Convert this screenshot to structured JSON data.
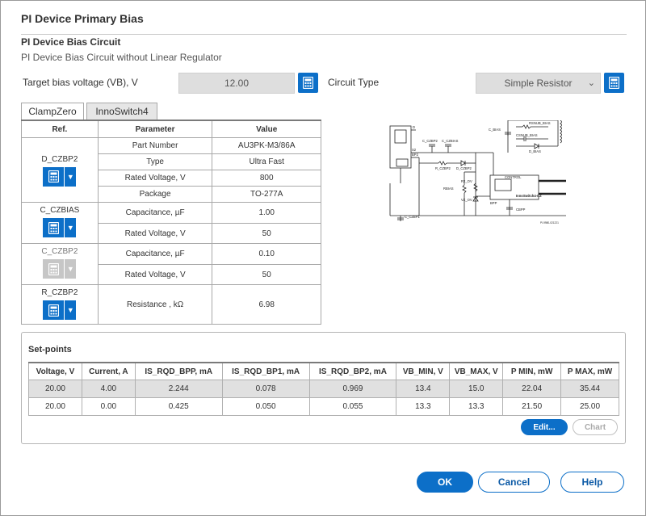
{
  "dialog": {
    "title": "PI Device Primary Bias",
    "section_title": "PI Device Bias Circuit",
    "section_subtitle": "PI Device Bias Circuit without Linear Regulator"
  },
  "inputs": {
    "target_bias_label": "Target bias voltage (VB), V",
    "target_bias_value": "12.00",
    "circuit_type_label": "Circuit Type",
    "circuit_type_value": "Simple Resistor"
  },
  "tabs": [
    {
      "label": "ClampZero",
      "active": true
    },
    {
      "label": "InnoSwitch4",
      "active": false
    }
  ],
  "components_table": {
    "headers": [
      "Ref.",
      "Parameter",
      "Value"
    ],
    "groups": [
      {
        "ref": "D_CZBP2",
        "enabled": true,
        "rows": [
          {
            "parameter": "Part Number",
            "value": "AU3PK-M3/86A"
          },
          {
            "parameter": "Type",
            "value": "Ultra Fast"
          },
          {
            "parameter": "Rated Voltage, V",
            "value": "800"
          },
          {
            "parameter": "Package",
            "value": "TO-277A"
          }
        ]
      },
      {
        "ref": "C_CZBIAS",
        "enabled": true,
        "rows": [
          {
            "parameter": "Capacitance, µF",
            "value": "1.00"
          },
          {
            "parameter": "Rated Voltage, V",
            "value": "50"
          }
        ]
      },
      {
        "ref": "C_CZBP2",
        "enabled": false,
        "rows": [
          {
            "parameter": "Capacitance, µF",
            "value": "0.10"
          },
          {
            "parameter": "Rated Voltage, V",
            "value": "50"
          }
        ]
      },
      {
        "ref": "R_CZBP2",
        "enabled": true,
        "rows": [
          {
            "parameter": "Resistance , kΩ",
            "value": "6.98"
          }
        ]
      }
    ]
  },
  "schematic": {
    "labels": {
      "d": "D",
      "s2": "S2",
      "bp2": "BP2",
      "c_czbp2": "C_CZBP2",
      "c_czbias": "C_CZBIAS",
      "r_czbp2": "R_CZBP2",
      "d_czbp2": "D_CZBP2",
      "c_bias": "C_BIAS",
      "rsnub_bias": "RSNUB_BIAS",
      "csnub_bias": "CSNUB_BIAS",
      "d_bias": "D_BIAS",
      "control": "CONTROL",
      "rbias": "RBIAS",
      "r_ov": "R2_OV",
      "vz_ov": "VZ_OV",
      "bpp": "BPP",
      "innoswitch": "InnoSwitch4-CZ",
      "cbpp": "CBPP",
      "c_czbp1": "C_CZBP1",
      "drawing_id": "PI-9980-021221"
    }
  },
  "setpoints": {
    "title": "Set-points",
    "headers": [
      "Voltage, V",
      "Current, A",
      "IS_RQD_BPP, mA",
      "IS_RQD_BP1, mA",
      "IS_RQD_BP2, mA",
      "VB_MIN, V",
      "VB_MAX, V",
      "P MIN, mW",
      "P MAX, mW"
    ],
    "rows": [
      [
        "20.00",
        "4.00",
        "2.244",
        "0.078",
        "0.969",
        "13.4",
        "15.0",
        "22.04",
        "35.44"
      ],
      [
        "20.00",
        "0.00",
        "0.425",
        "0.050",
        "0.055",
        "13.3",
        "13.3",
        "21.50",
        "25.00"
      ]
    ],
    "edit_label": "Edit...",
    "chart_label": "Chart"
  },
  "buttons": {
    "ok": "OK",
    "cancel": "Cancel",
    "help": "Help"
  },
  "colors": {
    "accent": "#0c6fc8",
    "disabled": "#c6c6c6",
    "readonly_bg": "#dedede"
  },
  "icons": {
    "calculator": "calculator-icon",
    "dropdown": "chevron-down-icon"
  }
}
